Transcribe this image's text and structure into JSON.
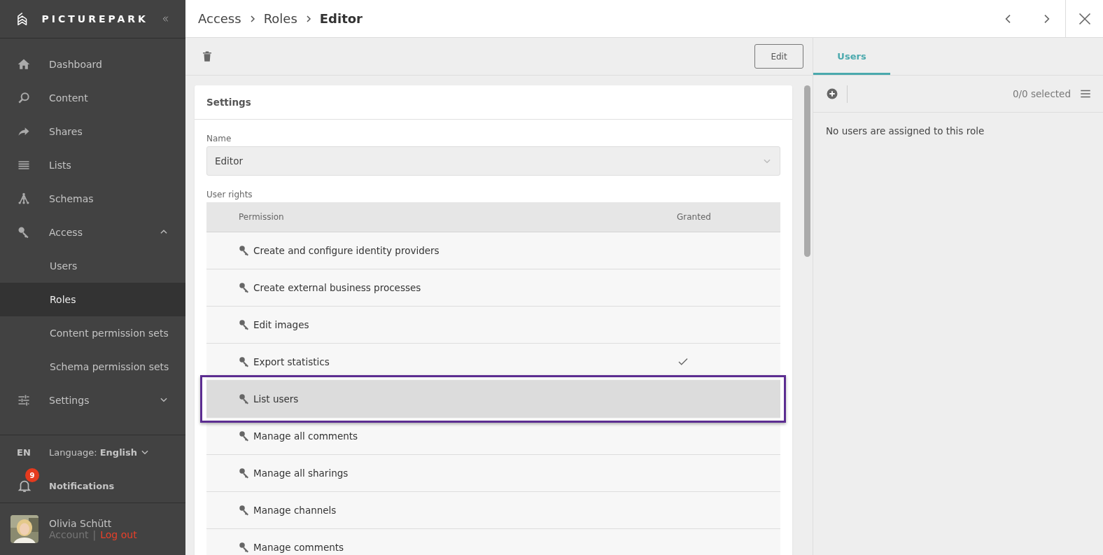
{
  "brand": {
    "name": "PICTUREPARK"
  },
  "nav": [
    {
      "label": "Dashboard",
      "selected": false
    },
    {
      "label": "Content",
      "selected": false
    },
    {
      "label": "Shares",
      "selected": false
    },
    {
      "label": "Lists",
      "selected": false
    },
    {
      "label": "Schemas",
      "selected": false
    },
    {
      "label": "Access",
      "selected": false,
      "expanded": true,
      "children": [
        {
          "label": "Users",
          "selected": false
        },
        {
          "label": "Roles",
          "selected": true
        },
        {
          "label": "Content permission sets",
          "selected": false
        },
        {
          "label": "Schema permission sets",
          "selected": false
        }
      ]
    },
    {
      "label": "Settings",
      "selected": false,
      "expanded": false
    }
  ],
  "language": {
    "code": "EN",
    "label": "Language:",
    "value": "English"
  },
  "notifications": {
    "label": "Notifications",
    "count": "9"
  },
  "user": {
    "name": "Olivia Schütt",
    "account": "Account",
    "separator": "|",
    "logout": "Log out"
  },
  "breadcrumb": [
    {
      "label": "Access",
      "current": false
    },
    {
      "label": "Roles",
      "current": false
    },
    {
      "label": "Editor",
      "current": true
    }
  ],
  "toolbar": {
    "edit": "Edit"
  },
  "settings": {
    "title": "Settings",
    "name_label": "Name",
    "name_value": "Editor",
    "rights_label": "User rights",
    "columns": [
      "Permission",
      "Granted"
    ],
    "rows": [
      {
        "permission": "Create and configure identity providers",
        "granted": false,
        "selected": false
      },
      {
        "permission": "Create external business processes",
        "granted": false,
        "selected": false
      },
      {
        "permission": "Edit images",
        "granted": false,
        "selected": false
      },
      {
        "permission": "Export statistics",
        "granted": true,
        "selected": false
      },
      {
        "permission": "List users",
        "granted": false,
        "selected": true
      },
      {
        "permission": "Manage all comments",
        "granted": false,
        "selected": false
      },
      {
        "permission": "Manage all sharings",
        "granted": false,
        "selected": false
      },
      {
        "permission": "Manage channels",
        "granted": false,
        "selected": false
      },
      {
        "permission": "Manage comments",
        "granted": false,
        "selected": false
      }
    ]
  },
  "side_panel": {
    "tabs": [
      {
        "label": "Users",
        "selected": true
      }
    ],
    "count": "0/0 selected",
    "empty_message": "No users are assigned to this role"
  }
}
